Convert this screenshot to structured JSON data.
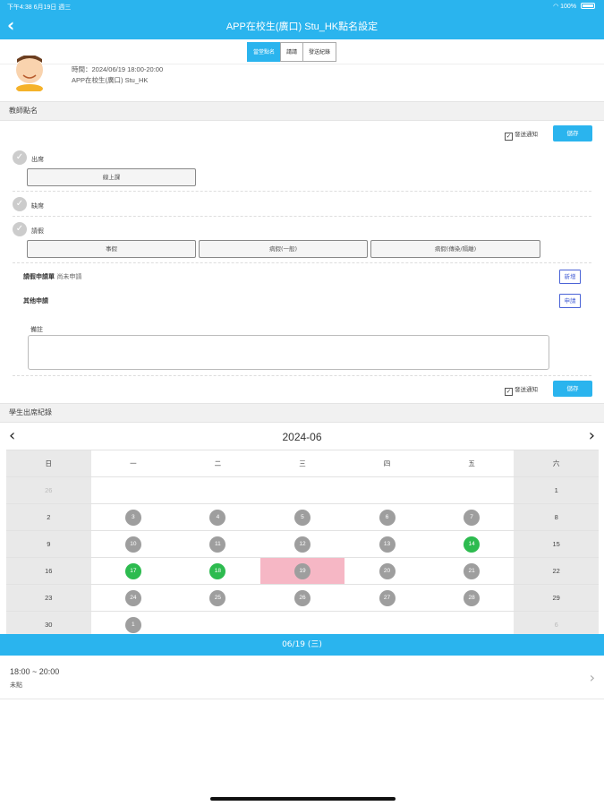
{
  "status_bar": {
    "time": "下午4:38",
    "date": "6月19日 週三",
    "battery": "100%"
  },
  "header": {
    "title": "APP在校生(廣口) Stu_HK點名設定"
  },
  "tabs": [
    "當堂點名",
    "請請",
    "發送紀錄"
  ],
  "lesson": {
    "time_line": "時間：2024/06/19 18:00-20:00",
    "class_line": "APP在校生(廣口) Stu_HK"
  },
  "teacher_section": {
    "heading": "教師點名",
    "notify_label": "發送通知",
    "save_label": "儲存",
    "present_label": "出席",
    "online_button": "線上課",
    "absent_label": "缺席",
    "leave_label": "請假",
    "leave_buttons": [
      "事假",
      "病假(一般)",
      "病假(傳染/隔離)"
    ],
    "leave_request_label": "請假申請單",
    "leave_request_status": "尚未申請",
    "add_link": "新增",
    "other_request_label": "其他申請",
    "request_link": "申請",
    "remark_label": "備註"
  },
  "student_section": {
    "heading": "學生出席紀錄"
  },
  "calendar": {
    "month": "2024-06",
    "weekdays": [
      "日",
      "一",
      "二",
      "三",
      "四",
      "五",
      "六"
    ],
    "weeks": [
      [
        {
          "d": "26",
          "s": "muted"
        },
        {
          "d": "",
          "s": "none"
        },
        {
          "d": "",
          "s": "none"
        },
        {
          "d": "",
          "s": "none"
        },
        {
          "d": "",
          "s": "none"
        },
        {
          "d": "",
          "s": "none"
        },
        {
          "d": "1",
          "s": "plain"
        }
      ],
      [
        {
          "d": "2",
          "s": "plain"
        },
        {
          "d": "3",
          "s": "gray"
        },
        {
          "d": "4",
          "s": "gray"
        },
        {
          "d": "5",
          "s": "gray"
        },
        {
          "d": "6",
          "s": "gray"
        },
        {
          "d": "7",
          "s": "gray"
        },
        {
          "d": "8",
          "s": "plain"
        }
      ],
      [
        {
          "d": "9",
          "s": "plain"
        },
        {
          "d": "10",
          "s": "gray"
        },
        {
          "d": "11",
          "s": "gray"
        },
        {
          "d": "12",
          "s": "gray"
        },
        {
          "d": "13",
          "s": "gray"
        },
        {
          "d": "14",
          "s": "green"
        },
        {
          "d": "15",
          "s": "plain"
        }
      ],
      [
        {
          "d": "16",
          "s": "plain"
        },
        {
          "d": "17",
          "s": "green"
        },
        {
          "d": "18",
          "s": "green"
        },
        {
          "d": "19",
          "s": "selected"
        },
        {
          "d": "20",
          "s": "gray"
        },
        {
          "d": "21",
          "s": "gray"
        },
        {
          "d": "22",
          "s": "plain"
        }
      ],
      [
        {
          "d": "23",
          "s": "plain"
        },
        {
          "d": "24",
          "s": "gray"
        },
        {
          "d": "25",
          "s": "gray"
        },
        {
          "d": "26",
          "s": "gray"
        },
        {
          "d": "27",
          "s": "gray"
        },
        {
          "d": "28",
          "s": "gray"
        },
        {
          "d": "29",
          "s": "plain"
        }
      ],
      [
        {
          "d": "30",
          "s": "plain"
        },
        {
          "d": "1",
          "s": "gray"
        },
        {
          "d": "",
          "s": "none"
        },
        {
          "d": "",
          "s": "none"
        },
        {
          "d": "",
          "s": "none"
        },
        {
          "d": "",
          "s": "none"
        },
        {
          "d": "6",
          "s": "muted"
        }
      ]
    ]
  },
  "selected_date": "06/19 (三)",
  "session": {
    "time": "18:00 ~ 20:00",
    "status": "未點"
  },
  "colors": {
    "accent": "#2ab4ee",
    "green": "#2dbb4f",
    "gray_dot": "#9e9e9e",
    "selected": "#f6b7c5"
  }
}
